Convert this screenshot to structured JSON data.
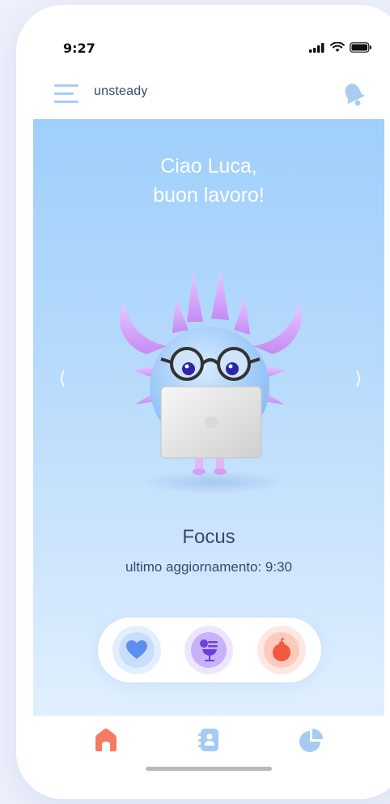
{
  "status_bar": {
    "time": "9:27"
  },
  "header": {
    "app_name": "unsteady"
  },
  "hero": {
    "greeting_line1": "Ciao Luca,",
    "greeting_line2": "buon lavoro!",
    "prev_arrow": "⟨",
    "next_arrow": "⟩"
  },
  "mood": {
    "title": "Focus",
    "updated": "ultimo aggiornamento: 9:30"
  },
  "mood_buttons": [
    {
      "name": "heart-icon",
      "color": "#5b8ef0"
    },
    {
      "name": "glass-icon",
      "color": "#6a3fe0"
    },
    {
      "name": "bomb-icon",
      "color": "#f25a40"
    }
  ],
  "tabs": [
    {
      "name": "home-icon",
      "color": "#f57c63",
      "active": true
    },
    {
      "name": "diary-icon",
      "color": "#a6cbf3"
    },
    {
      "name": "chart-pie-icon",
      "color": "#a6cbf3"
    }
  ],
  "colors": {
    "accent": "#3b4770",
    "hero_top": "#9fcffb",
    "hero_bottom": "#e0effe"
  }
}
